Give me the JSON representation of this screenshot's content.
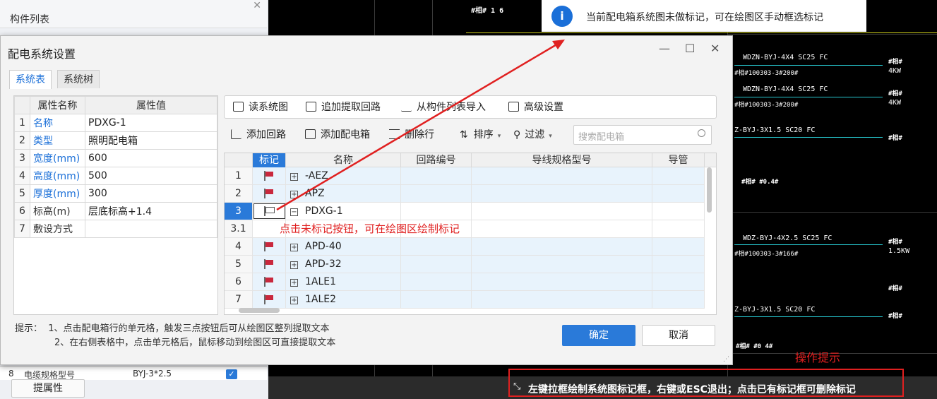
{
  "left_panel": {
    "title": "构件列表",
    "close_icon": "close-icon",
    "row8": {
      "index": "8",
      "name": "电缆规格型号",
      "value": "BYJ-3*2.5",
      "checked": true
    },
    "extract_button": "提属性"
  },
  "toast": {
    "icon": "info-icon",
    "text": "当前配电箱系统图未做标记，可在绘图区手动框选标记"
  },
  "cad": {
    "labels": {
      "top_id": "#相# 1 6",
      "l1": "WDZN-BYJ-4X4  SC25  FC",
      "l1s": "#相#100303-3#200#",
      "l1r1": "#相#",
      "l1r2": "4KW",
      "l2": "WDZN-BYJ-4X4  SC25  FC",
      "l2s": "#相#100303-3#200#",
      "l2r1": "#相#",
      "l2r2": "4KW",
      "l3": "Z-BYJ-3X1.5  SC20  FC",
      "l3r": "#相#",
      "l4": "#相# #0.4#",
      "l5": "WDZ-BYJ-4X2.5  SC25  FC",
      "l5s": "#相#100303-3#166#",
      "l5r1": "#相#",
      "l5r2": "1.5KW",
      "l6r": "#相#",
      "l7": "Z-BYJ-3X1.5  SC20  FC",
      "l7r": "#相#",
      "l8": "#相# #0 4#"
    }
  },
  "dialog": {
    "title": "配电系统设置",
    "controls": {
      "minimize": "minimize-icon",
      "maximize": "maximize-icon",
      "close": "close-icon"
    },
    "tabs": [
      {
        "label": "系统表",
        "active": true
      },
      {
        "label": "系统树",
        "active": false
      }
    ],
    "props": {
      "headers": [
        "属性名称",
        "属性值"
      ],
      "rows": [
        {
          "idx": "1",
          "name": "名称",
          "value": "PDXG-1",
          "linked": true
        },
        {
          "idx": "2",
          "name": "类型",
          "value": "照明配电箱",
          "linked": true
        },
        {
          "idx": "3",
          "name": "宽度(mm)",
          "value": "600",
          "linked": true
        },
        {
          "idx": "4",
          "name": "高度(mm)",
          "value": "500",
          "linked": true
        },
        {
          "idx": "5",
          "name": "厚度(mm)",
          "value": "300",
          "linked": true
        },
        {
          "idx": "6",
          "name": "标高(m)",
          "value": "层底标高+1.4",
          "linked": false
        },
        {
          "idx": "7",
          "name": "敷设方式",
          "value": "",
          "linked": false
        }
      ]
    },
    "toolbar1": [
      "读系统图",
      "追加提取回路",
      "从构件列表导入",
      "高级设置"
    ],
    "toolbar2": {
      "add_loop": "添加回路",
      "add_box": "添加配电箱",
      "delete_row": "删除行",
      "sort": "排序",
      "filter": "过滤",
      "search_placeholder": "搜索配电箱"
    },
    "grid": {
      "headers": [
        "标记",
        "名称",
        "回路编号",
        "导线规格型号",
        "导管"
      ],
      "rows": [
        {
          "rn": "1",
          "flag": "filled",
          "exp": "+",
          "name": "-AEZ"
        },
        {
          "rn": "2",
          "flag": "filled",
          "exp": "+",
          "name": "APZ"
        },
        {
          "rn": "3",
          "flag": "empty",
          "exp": "−",
          "name": "PDXG-1",
          "selected": true
        },
        {
          "rn": "3.1",
          "flag": "",
          "exp": "",
          "name": "",
          "sub": true
        },
        {
          "rn": "4",
          "flag": "filled",
          "exp": "+",
          "name": "APD-40"
        },
        {
          "rn": "5",
          "flag": "filled",
          "exp": "+",
          "name": "APD-32"
        },
        {
          "rn": "6",
          "flag": "filled",
          "exp": "+",
          "name": "1ALE1"
        },
        {
          "rn": "7",
          "flag": "filled",
          "exp": "+",
          "name": "1ALE2"
        }
      ],
      "annotation": "点击未标记按钮，可在绘图区绘制标记"
    },
    "hint": {
      "label": "提示：",
      "line1": "1、点击配电箱行的单元格，触发三点按钮后可从绘图区整列提取文本",
      "line2": "2、在右侧表格中，点击单元格后，鼠标移动到绘图区可直接提取文本"
    },
    "ok": "确定",
    "cancel": "取消"
  },
  "status": {
    "icon": "shrink-arrows-icon",
    "text": "左键拉框绘制系统图标记框，右键或ESC退出；点击已有标记框可删除标记",
    "tips_label": "操作提示"
  },
  "colors": {
    "accent": "#2a7ad9",
    "annotation_red": "#e02020",
    "cad_cyan": "#27c8d0",
    "cad_yellow": "#d6d61a"
  }
}
